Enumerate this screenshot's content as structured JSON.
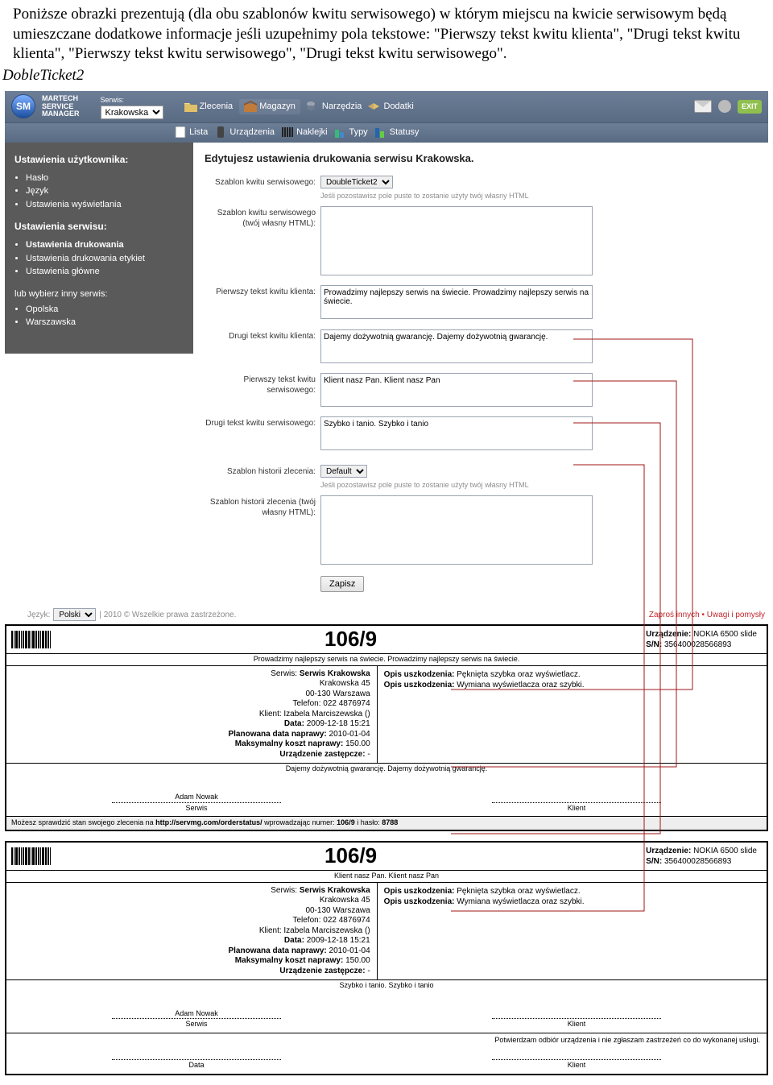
{
  "doc": {
    "para": "Poniższe obrazki prezentują (dla obu szablonów kwitu serwisowego) w którym miejscu na kwicie serwisowym będą umieszczane dodatkowe informacje jeśli uzupełnimy pola tekstowe: \"Pierwszy tekst kwitu klienta\", \"Drugi tekst kwitu klienta\", \"Pierwszy tekst kwitu serwisowego\", \"Drugi tekst kwitu serwisowego\".",
    "title": "DobleTicket2"
  },
  "header": {
    "brand1": "MARTECH",
    "brand2": "SERVICE",
    "brand3": "MANAGER",
    "service_label": "Serwis:",
    "service_value": "Krakowska",
    "nav1": [
      "Zlecenia",
      "Magazyn",
      "Narzędzia",
      "Dodatki"
    ],
    "nav2": [
      "Lista",
      "Urządzenia",
      "Naklejki",
      "Typy",
      "Statusy"
    ],
    "exit": "EXIT"
  },
  "sidebar": {
    "h1": "Ustawienia użytkownika:",
    "list1": [
      "Hasło",
      "Język",
      "Ustawienia wyświetlania"
    ],
    "h2": "Ustawienia serwisu:",
    "list2": [
      "Ustawienia drukowania",
      "Ustawienia drukowania etykiet",
      "Ustawienia główne"
    ],
    "h3": "lub wybierz inny serwis:",
    "list3": [
      "Opolska",
      "Warszawska"
    ]
  },
  "form": {
    "heading": "Edytujesz ustawienia drukowania serwisu Krakowska.",
    "lab_template": "Szablon kwitu serwisowego:",
    "template_value": "DoubleTicket2",
    "hint1": "Jeśli pozostawisz pole puste to zostanie użyty twój własny HTML",
    "lab_template_html": "Szablon kwitu serwisowego (twój własny HTML):",
    "lab_t1": "Pierwszy tekst kwitu klienta:",
    "val_t1": "Prowadzimy najlepszy serwis na świecie. Prowadzimy najlepszy serwis na świecie.",
    "lab_t2": "Drugi tekst kwitu klienta:",
    "val_t2": "Dajemy dożywotnią gwarancję. Dajemy dożywotnią gwarancję.",
    "lab_t3": "Pierwszy tekst kwitu serwisowego:",
    "val_t3": "Klient nasz Pan. Klient nasz Pan",
    "lab_t4": "Drugi tekst kwitu serwisowego:",
    "val_t4": "Szybko i tanio. Szybko i tanio",
    "lab_hist": "Szablon historii zlecenia:",
    "hist_value": "Default",
    "hint2": "Jeśli pozostawisz pole puste to zostanie użyty twój własny HTML",
    "lab_hist_html": "Szablon historii zlecenia (twój własny HTML):",
    "save": "Zapisz"
  },
  "footer": {
    "lang_label": "Język:",
    "lang_value": "Polski",
    "copy": "| 2010 © Wszelkie prawa zastrzeżone.",
    "right": "Zaproś innych • Uwagi i pomysły"
  },
  "ticket": {
    "number": "106/9",
    "dev_label": "Urządzenie:",
    "dev_value": "NOKIA 6500 slide",
    "sn_label": "S/N:",
    "sn_value": "356400028566893",
    "row1": "Prowadzimy najlepszy serwis na świecie. Prowadzimy najlepszy serwis na świecie.",
    "left_block": {
      "l1a": "Serwis:",
      "l1b": "Serwis Krakowska",
      "l2": "Krakowska 45",
      "l3": "00-130 Warszawa",
      "l4a": "Telefon:",
      "l4b": "022 4876974",
      "l5a": "Klient:",
      "l5b": "Izabela Marciszewska ()",
      "l6a": "Data:",
      "l6b": "2009-12-18 15:21",
      "l7a": "Planowana data naprawy:",
      "l7b": "2010-01-04",
      "l8a": "Maksymalny koszt naprawy:",
      "l8b": "150.00",
      "l9a": "Urządzenie zastępcze:",
      "l9b": "-"
    },
    "right_block": {
      "r1a": "Opis uszkodzenia:",
      "r1b": "Pęknięta szybka oraz wyświetlacz.",
      "r2a": "Opis uszkodzenia:",
      "r2b": "Wymiana wyświetlacza oraz szybki."
    },
    "row2": "Dajemy dożywotnią gwarancję. Dajemy dożywotnią gwarancję.",
    "sig_l": "Adam Nowak",
    "sig_l2": "Serwis",
    "sig_r2": "Klient",
    "footline_a": "Możesz sprawdzić stan swojego zlecenia na ",
    "footline_b": "http://servmg.com/orderstatus/",
    "footline_c": " wprowadzając numer: ",
    "footline_d": "106/9",
    "footline_e": " i hasło: ",
    "footline_f": "8788"
  },
  "ticket2": {
    "row1": "Klient nasz Pan. Klient nasz Pan",
    "row2": "Szybko i tanio. Szybko i tanio",
    "bottom1": "Potwierdzam odbiór urządzenia i nie zgłaszam zastrzeżeń co do wykonanej usługi.",
    "sig_date": "Data",
    "sig_klient": "Klient"
  }
}
